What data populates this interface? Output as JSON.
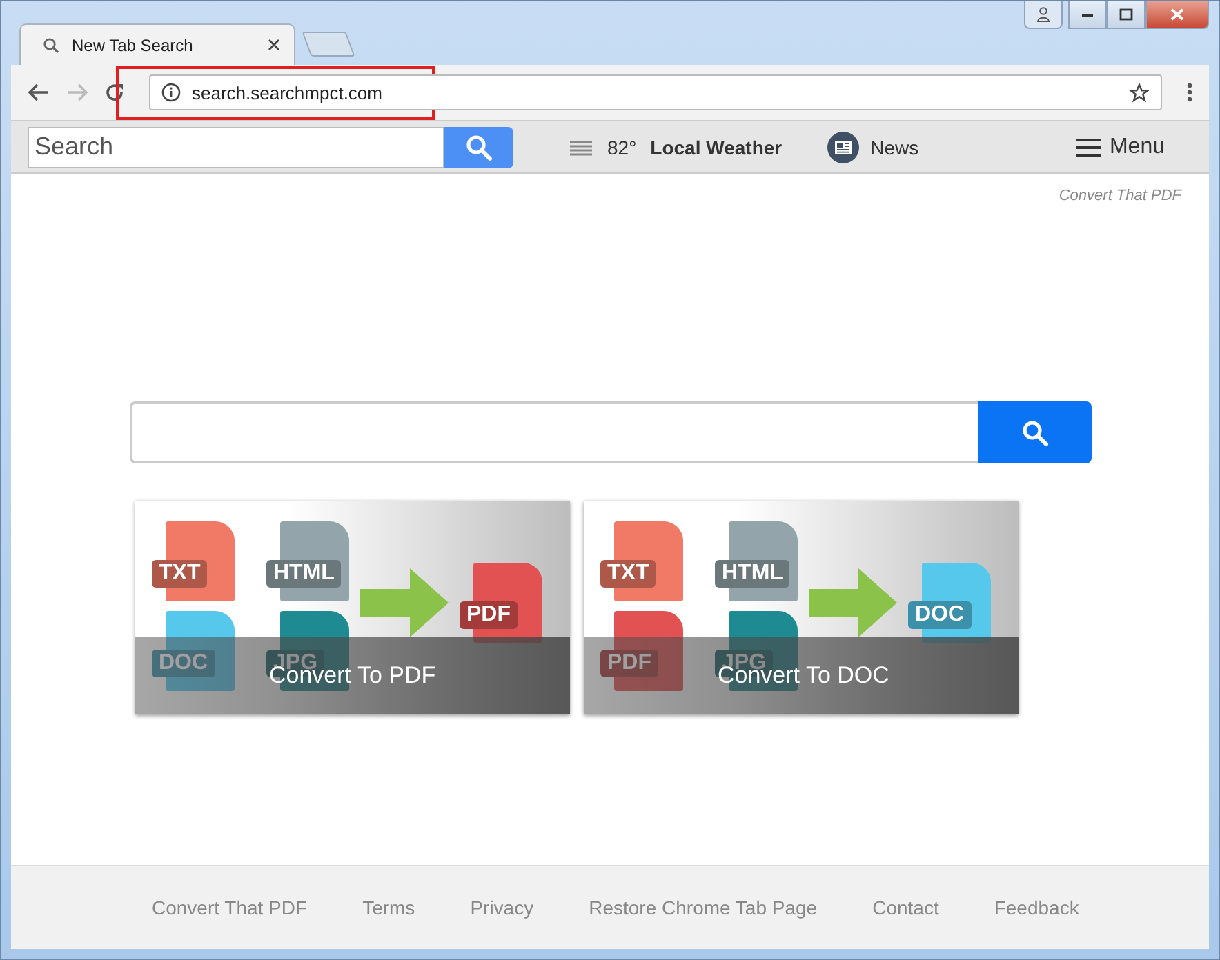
{
  "window": {
    "tab_title": "New Tab Search"
  },
  "address_bar": {
    "url": "search.searchmpct.com",
    "highlighted": true
  },
  "nav": {
    "search": {
      "placeholder": "Search"
    },
    "weather": {
      "temperature": "82°",
      "label": "Local Weather"
    },
    "news": "News",
    "menu": "Menu"
  },
  "brand_link": "Convert That PDF",
  "cards": [
    {
      "caption": "Convert To PDF",
      "sources": [
        {
          "label": "TXT",
          "color": "#f07a66"
        },
        {
          "label": "HTML",
          "color": "#93a5ab"
        },
        {
          "label": "DOC",
          "color": "#55c8ec"
        },
        {
          "label": "JPG",
          "color": "#1e8a92"
        }
      ],
      "target": {
        "label": "PDF",
        "color": "#e35252"
      }
    },
    {
      "caption": "Convert To DOC",
      "sources": [
        {
          "label": "TXT",
          "color": "#f07a66"
        },
        {
          "label": "HTML",
          "color": "#93a5ab"
        },
        {
          "label": "PDF",
          "color": "#e35252"
        },
        {
          "label": "JPG",
          "color": "#1e8a92"
        }
      ],
      "target": {
        "label": "DOC",
        "color": "#55c8ec"
      }
    }
  ],
  "footer": [
    "Convert That PDF",
    "Terms",
    "Privacy",
    "Restore Chrome Tab Page",
    "Contact",
    "Feedback"
  ]
}
